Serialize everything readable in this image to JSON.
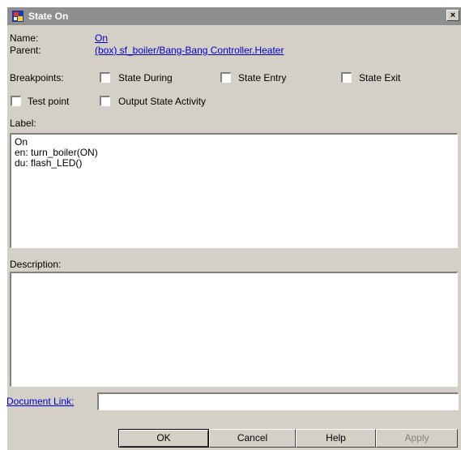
{
  "window": {
    "title": "State On",
    "close_glyph": "×"
  },
  "fields": {
    "name_label": "Name:",
    "name_value": "On",
    "parent_label": "Parent:",
    "parent_value": "(box) sf_boiler/Bang-Bang Controller.Heater",
    "breakpoints_label": "Breakpoints:"
  },
  "checkboxes": {
    "state_during": {
      "label": "State During",
      "checked": false
    },
    "state_entry": {
      "label": "State Entry",
      "checked": false
    },
    "state_exit": {
      "label": "State Exit",
      "checked": false
    },
    "test_point": {
      "label": "Test point",
      "checked": false
    },
    "output_state_activity": {
      "label": "Output State Activity",
      "checked": false
    }
  },
  "label_section": {
    "heading": "Label:",
    "lines": [
      "On",
      "en: turn_boiler(ON)",
      "du: flash_LED()"
    ]
  },
  "description_section": {
    "heading": "Description:",
    "value": ""
  },
  "document_link": {
    "label": "Document Link:",
    "value": ""
  },
  "buttons": {
    "ok": "OK",
    "cancel": "Cancel",
    "help": "Help",
    "apply": "Apply"
  },
  "icons": {
    "title_icon": "stateflow-state-icon",
    "close_icon": "close-icon"
  }
}
